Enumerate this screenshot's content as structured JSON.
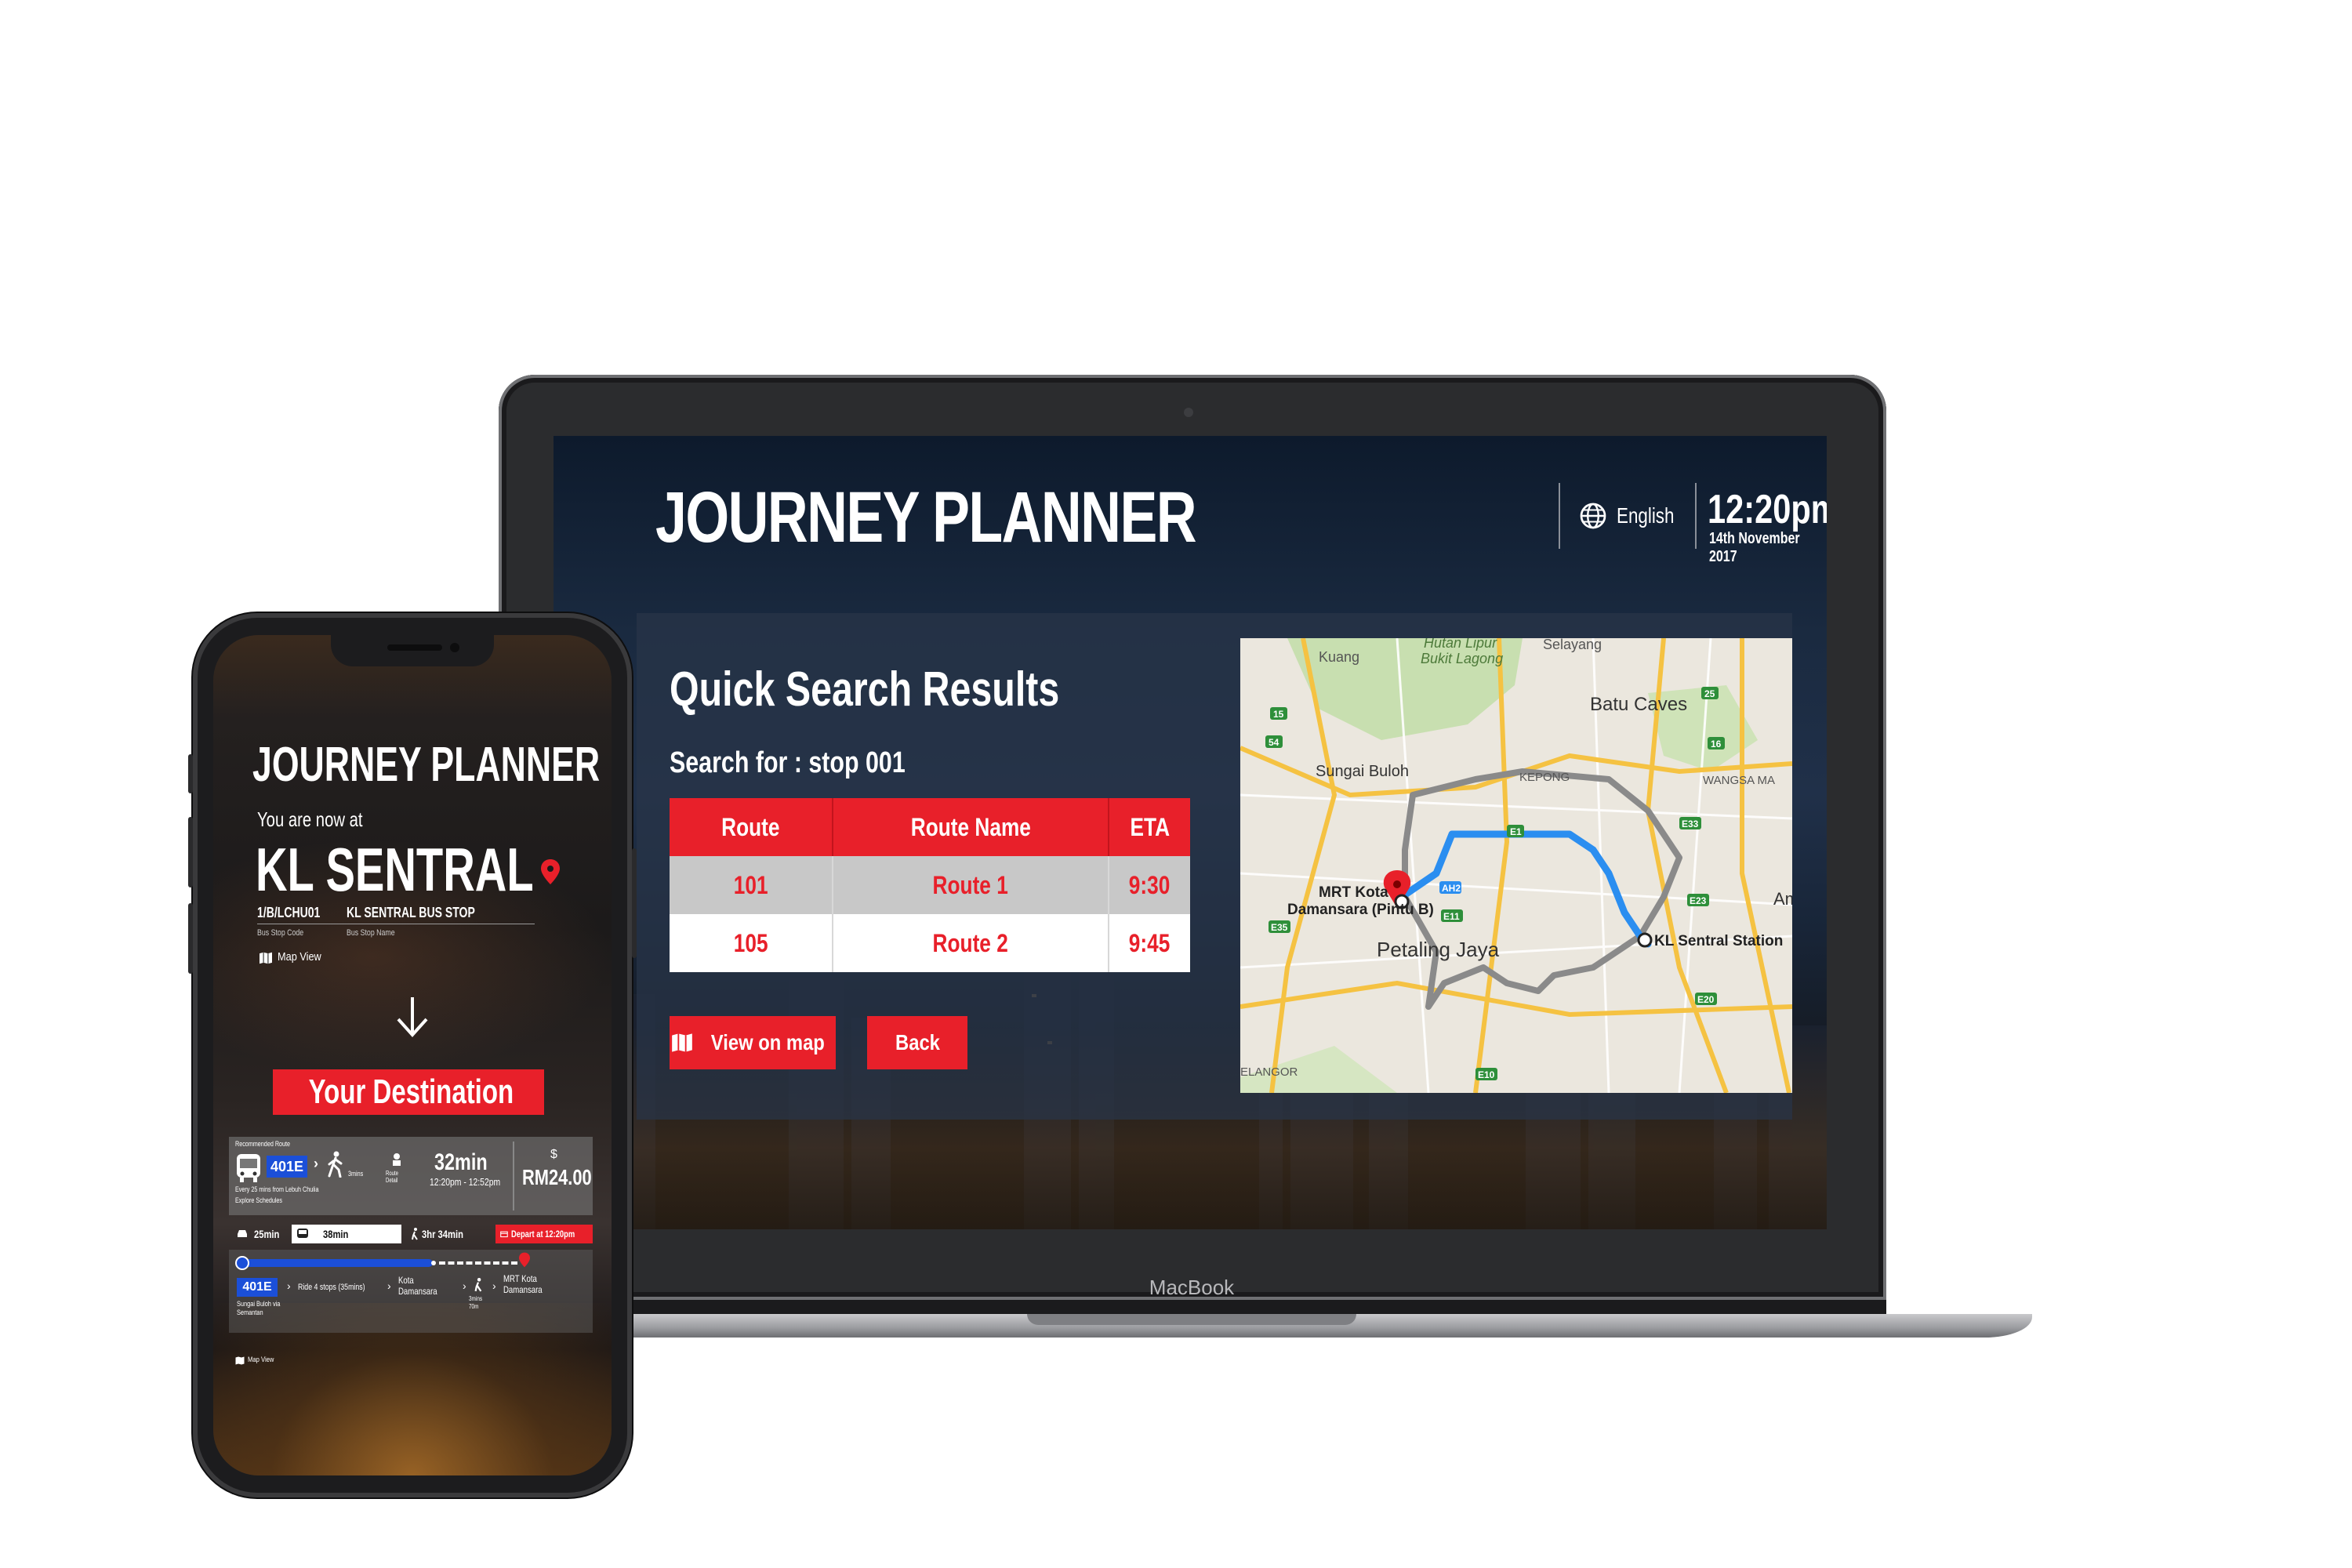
{
  "laptop": {
    "brand_label": "MacBook",
    "app_title": "JOURNEY PLANNER",
    "language": "English",
    "time": "12:20pm",
    "date": "14th November 2017",
    "results": {
      "heading": "Quick Search Results",
      "search_for": "Search for : stop 001",
      "columns": [
        "Route",
        "Route Name",
        "ETA"
      ],
      "rows": [
        {
          "route": "101",
          "name": "Route 1",
          "eta": "9:30"
        },
        {
          "route": "105",
          "name": "Route 2",
          "eta": "9:45"
        }
      ],
      "view_on_map_label": "View on map",
      "back_label": "Back"
    },
    "map": {
      "labels": {
        "kuang": "Kuang",
        "hutan": "Hutan Lipur",
        "bukit": "Bukit Lagong",
        "selayang": "Selayang",
        "batu_caves": "Batu Caves",
        "sungai_buloh": "Sungai Buloh",
        "kepong": "KEPONG",
        "wangsa": "WANGSA MA",
        "mrt_kota": "MRT Kota",
        "damansara": "Damansara (Pintu B)",
        "petaling": "Petaling Jaya",
        "kl_sentral": "KL Sentral Station",
        "am": "Am",
        "elangor": "ELANGOR",
        "ah2": "AH2",
        "e1": "E1",
        "e11": "E11",
        "e10": "E10",
        "e35": "E35",
        "e20": "E20",
        "e23": "E23",
        "e33": "E33",
        "r54": "54",
        "r15": "15",
        "r25": "25",
        "r16": "16"
      },
      "route_color": "#2b8ef0",
      "alt_route_color": "#8a8a8a",
      "pin_color": "#e8202a"
    }
  },
  "phone": {
    "app_title": "JOURNEY PLANNER",
    "you_are_now_at": "You are now at",
    "station": "KL SENTRAL",
    "bus_stop_code": "1/B/LCHU01",
    "bus_stop_name": "KL SENTRAL BUS STOP",
    "bus_stop_code_label": "Bus Stop Code",
    "bus_stop_name_label": "Bus Stop Name",
    "map_view_label": "Map View",
    "destination_label": "Your Destination",
    "recommended": {
      "label": "Recommended Route",
      "bus": "401E",
      "frequency": "Every 25 mins from Lebuh Chulia",
      "explore": "Explore Schedules",
      "walk": "3mins",
      "route_detail": "Route Detail",
      "duration": "32min",
      "time_range": "12:20pm - 12:52pm",
      "currency": "$",
      "fare": "RM24.00"
    },
    "options": {
      "car": "25min",
      "bus": "38min",
      "walk": "3hr 34min",
      "depart": "Depart at 12:20pm"
    },
    "journey": {
      "bus": "401E",
      "from": "Sungai Buloh via Semantan",
      "ride": "Ride 4 stops (35mins)",
      "stop": "Kota Damansara",
      "walk": "3mins 70m",
      "end": "MRT Kota Damansara"
    },
    "footer_map_view": "Map View"
  },
  "colors": {
    "accent_red": "#e8202a",
    "bus_blue": "#1b4fd8"
  }
}
